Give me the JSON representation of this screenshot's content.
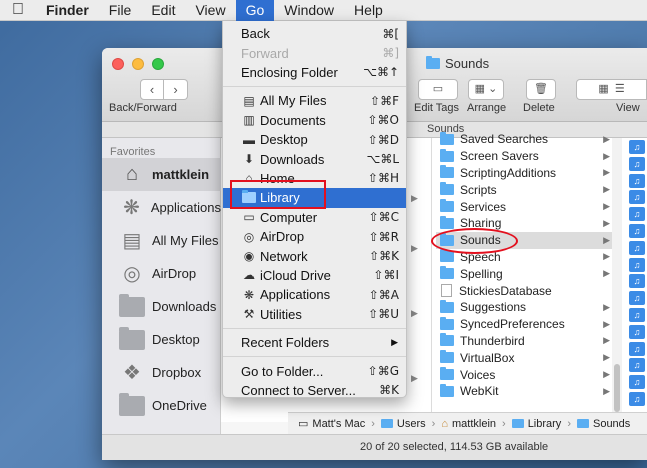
{
  "menubar": {
    "apple_icon": "apple-icon",
    "items": [
      "Finder",
      "File",
      "Edit",
      "View",
      "Go",
      "Window",
      "Help"
    ],
    "active": "Go"
  },
  "window": {
    "title": "Sounds",
    "toolbar": {
      "back_forward_label": "Back/Forward",
      "edit_tags_label": "Edit Tags",
      "arrange_label": "Arrange",
      "delete_label": "Delete",
      "view_label": "View"
    },
    "path_header": "Sounds",
    "sidebar": {
      "heading": "Favorites",
      "items": [
        {
          "label": "mattklein",
          "icon": "home-icon",
          "selected": true
        },
        {
          "label": "Applications",
          "icon": "applications-icon"
        },
        {
          "label": "All My Files",
          "icon": "all-my-files-icon"
        },
        {
          "label": "AirDrop",
          "icon": "airdrop-icon"
        },
        {
          "label": "Downloads",
          "icon": "folder-icon"
        },
        {
          "label": "Desktop",
          "icon": "folder-icon"
        },
        {
          "label": "Dropbox",
          "icon": "dropbox-icon"
        },
        {
          "label": "OneDrive",
          "icon": "folder-icon"
        }
      ]
    },
    "library_items": [
      {
        "label": "Saved Searches",
        "type": "folder"
      },
      {
        "label": "Screen Savers",
        "type": "folder"
      },
      {
        "label": "ScriptingAdditions",
        "type": "folder"
      },
      {
        "label": "Scripts",
        "type": "folder"
      },
      {
        "label": "Services",
        "type": "folder"
      },
      {
        "label": "Sharing",
        "type": "folder"
      },
      {
        "label": "Sounds",
        "type": "folder",
        "selected": true
      },
      {
        "label": "Speech",
        "type": "folder"
      },
      {
        "label": "Spelling",
        "type": "folder"
      },
      {
        "label": "StickiesDatabase",
        "type": "file"
      },
      {
        "label": "Suggestions",
        "type": "folder"
      },
      {
        "label": "SyncedPreferences",
        "type": "folder"
      },
      {
        "label": "Thunderbird",
        "type": "folder"
      },
      {
        "label": "VirtualBox",
        "type": "folder"
      },
      {
        "label": "Voices",
        "type": "folder"
      },
      {
        "label": "WebKit",
        "type": "folder"
      }
    ],
    "pathbar": [
      "Matt's Mac",
      "Users",
      "mattklein",
      "Library",
      "Sounds"
    ],
    "status": "20 of 20 selected, 114.53 GB available"
  },
  "go_menu": {
    "items": [
      {
        "label": "Back",
        "shortcut": "⌘["
      },
      {
        "label": "Forward",
        "shortcut": "⌘]",
        "disabled": true
      },
      {
        "label": "Enclosing Folder",
        "shortcut": "⌥⌘↑"
      },
      {
        "separator": true
      },
      {
        "label": "All My Files",
        "shortcut": "⇧⌘F",
        "icon": "all-my-files-icon"
      },
      {
        "label": "Documents",
        "shortcut": "⇧⌘O",
        "icon": "documents-icon"
      },
      {
        "label": "Desktop",
        "shortcut": "⇧⌘D",
        "icon": "desktop-icon"
      },
      {
        "label": "Downloads",
        "shortcut": "⌥⌘L",
        "icon": "downloads-icon"
      },
      {
        "label": "Home",
        "shortcut": "⇧⌘H",
        "icon": "home-icon"
      },
      {
        "label": "Library",
        "shortcut": "",
        "icon": "folder-icon",
        "highlighted": true
      },
      {
        "label": "Computer",
        "shortcut": "⇧⌘C",
        "icon": "computer-icon"
      },
      {
        "label": "AirDrop",
        "shortcut": "⇧⌘R",
        "icon": "airdrop-icon"
      },
      {
        "label": "Network",
        "shortcut": "⇧⌘K",
        "icon": "network-icon"
      },
      {
        "label": "iCloud Drive",
        "shortcut": "⇧⌘I",
        "icon": "icloud-icon"
      },
      {
        "label": "Applications",
        "shortcut": "⇧⌘A",
        "icon": "applications-icon"
      },
      {
        "label": "Utilities",
        "shortcut": "⇧⌘U",
        "icon": "utilities-icon"
      },
      {
        "separator": true
      },
      {
        "label": "Recent Folders",
        "submenu": true
      },
      {
        "separator": true
      },
      {
        "label": "Go to Folder...",
        "shortcut": "⇧⌘G"
      },
      {
        "label": "Connect to Server...",
        "shortcut": "⌘K"
      }
    ]
  },
  "annotations": {
    "box_color": "#e3101e",
    "ellipse_color": "#e3101e"
  },
  "colors": {
    "accent": "#2f6fd1",
    "folder": "#5aaef2"
  }
}
